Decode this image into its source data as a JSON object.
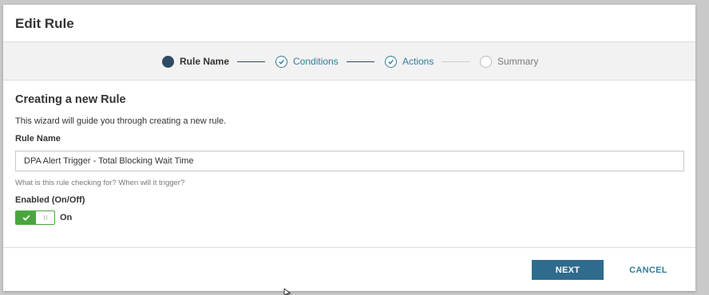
{
  "dialog": {
    "title": "Edit Rule"
  },
  "stepper": {
    "steps": [
      {
        "label": "Rule Name",
        "state": "current"
      },
      {
        "label": "Conditions",
        "state": "done"
      },
      {
        "label": "Actions",
        "state": "done"
      },
      {
        "label": "Summary",
        "state": "todo"
      }
    ]
  },
  "body": {
    "section_title": "Creating a new Rule",
    "intro": "This wizard will guide you through creating a new rule.",
    "rule_name_label": "Rule Name",
    "rule_name_value": "DPA Alert Trigger - Total Blocking Wait Time",
    "rule_name_help": "What is this rule checking for? When will it trigger?",
    "enabled_label": "Enabled (On/Off)",
    "enabled_state": "On"
  },
  "footer": {
    "next_label": "NEXT",
    "cancel_label": "CANCEL"
  },
  "colors": {
    "primary": "#2f6b8c",
    "link": "#2f7f9a",
    "toggle_on": "#4aa63c",
    "step_current": "#2f4a64"
  }
}
